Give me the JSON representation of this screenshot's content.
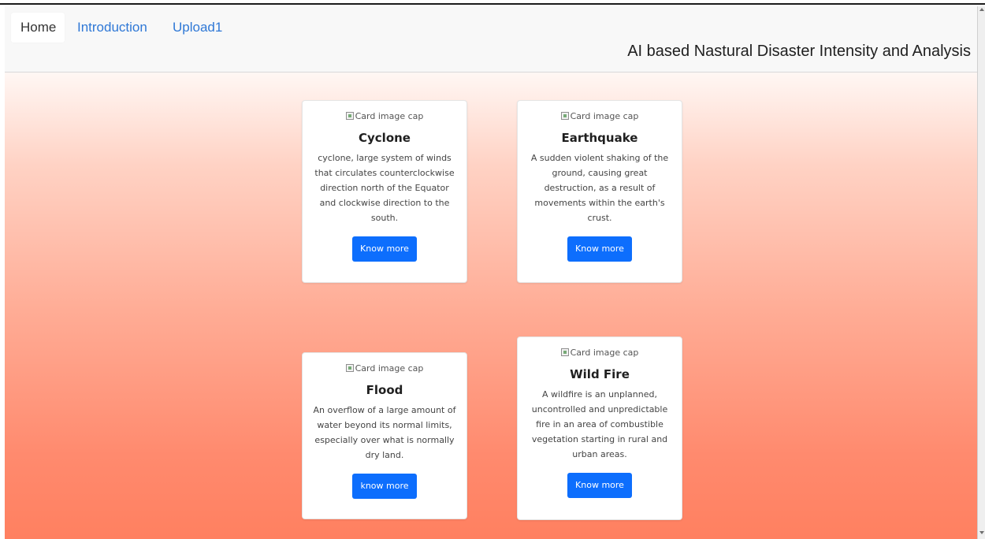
{
  "nav": {
    "tabs": [
      {
        "label": "Home"
      },
      {
        "label": "Introduction"
      },
      {
        "label": "Upload1"
      }
    ],
    "title": "AI based Nastural Disaster Intensity and Analysis"
  },
  "cards": [
    {
      "image_alt": "Card image cap",
      "title": "Cyclone",
      "text": "cyclone, large system of winds that circulates counterclockwise direction north of the Equator and clockwise direction to the south.",
      "button": "Know more"
    },
    {
      "image_alt": "Card image cap",
      "title": "Earthquake",
      "text": "A sudden violent shaking of the ground, causing great destruction, as a result of movements within the earth's crust.",
      "button": "Know more"
    },
    {
      "image_alt": "Card image cap",
      "title": "Flood",
      "text": "An overflow of a large amount of water beyond its normal limits, especially over what is normally dry land.",
      "button": "know more"
    },
    {
      "image_alt": "Card image cap",
      "title": "Wild Fire",
      "text": "A wildfire is an unplanned, uncontrolled and unpredictable fire in an area of combustible vegetation starting in rural and urban areas.",
      "button": "Know more"
    }
  ],
  "icons": {
    "image_placeholder": "broken-image-icon"
  },
  "colors": {
    "link": "#2f78d6",
    "button": "#0d6efd",
    "background_top": "#fff7f4",
    "background_bottom": "#ff8060"
  }
}
